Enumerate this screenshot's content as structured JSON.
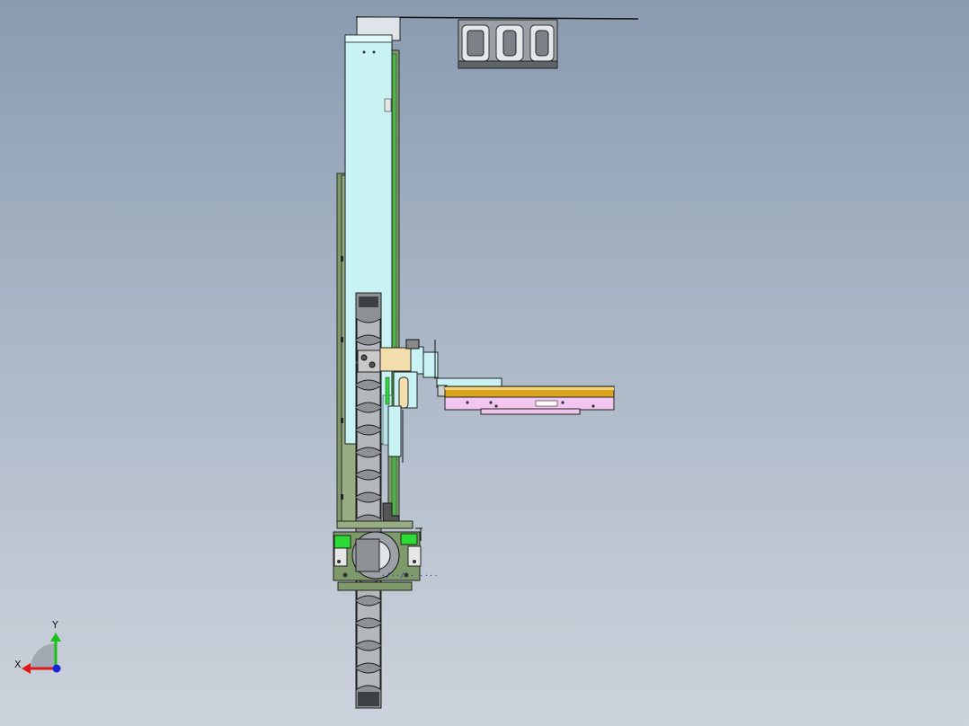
{
  "viewport": {
    "background_top": "#8a9bb0",
    "background_bottom": "#cdd3dc",
    "colors": {
      "frame_green": "#7f9a6a",
      "cover_cyan": "#c8f2f4",
      "slide_pink": "#f3c6ef",
      "rail_gold": "#d9a520",
      "chain_gray": "#8e9297",
      "block_tan": "#f3dfae",
      "bright_green": "#2cdc34",
      "annotation_blue": "#1e2bd6"
    }
  },
  "annotation": {
    "text": "·/··/ · ····"
  },
  "triad": {
    "x_label": "X",
    "y_label": "Y",
    "x_color": "#e01818",
    "y_color": "#19c019",
    "z_color": "#1a22d8"
  }
}
